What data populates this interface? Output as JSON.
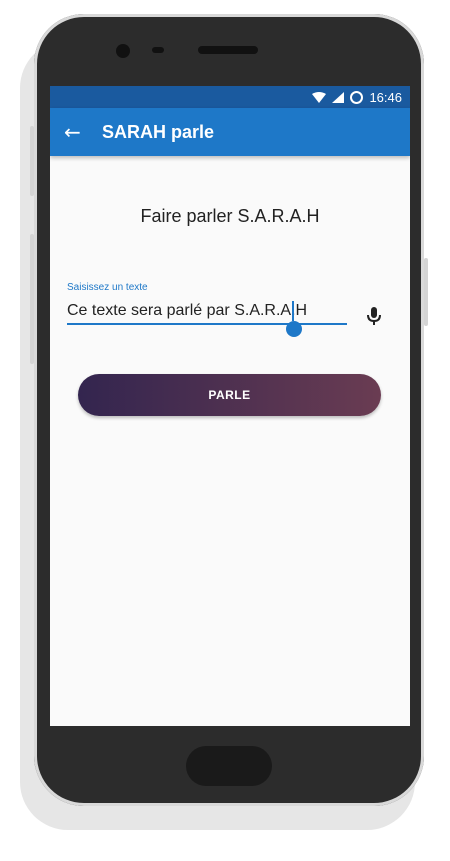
{
  "colors": {
    "status_bar": "#1a5a9f",
    "app_bar": "#1e78c8",
    "accent": "#1e78c8",
    "button_gradient_start": "#33254f",
    "button_gradient_end": "#6a3c52"
  },
  "status": {
    "time": "16:46",
    "icons": [
      "wifi-icon",
      "signal-icon",
      "ring-icon"
    ]
  },
  "app_bar": {
    "back_icon": "arrow-left-icon",
    "title": "SARAH parle"
  },
  "main": {
    "heading": "Faire parler S.A.R.A.H",
    "input": {
      "label": "Saisissez un texte",
      "value": "Ce texte sera parlé par S.A.R.A.H"
    },
    "mic_icon": "microphone-icon",
    "speak_button": "PARLE"
  }
}
